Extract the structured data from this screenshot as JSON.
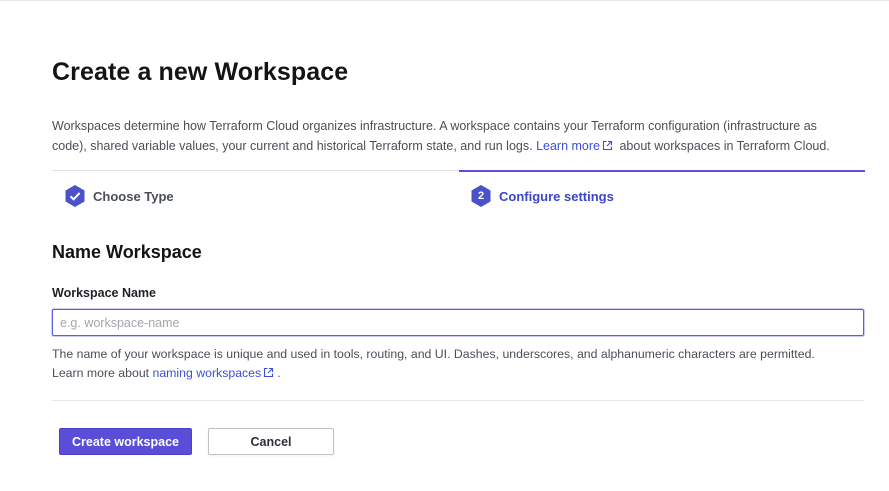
{
  "page": {
    "title": "Create a new Workspace",
    "intro_text": "Workspaces determine how Terraform Cloud organizes infrastructure. A workspace contains your Terraform configuration (infrastructure as code), shared variable values, your current and historical Terraform state, and run logs.",
    "intro_link": "Learn more",
    "intro_suffix": "about workspaces in Terraform Cloud."
  },
  "steps": [
    {
      "label": "Choose Type",
      "status": "complete",
      "icon": "check-icon"
    },
    {
      "number": "2",
      "label": "Configure settings",
      "status": "active"
    }
  ],
  "form": {
    "section_title": "Name Workspace",
    "field_label": "Workspace Name",
    "input_value": "",
    "input_placeholder": "e.g. workspace-name",
    "help_text": "The name of your workspace is unique and used in tools, routing, and UI. Dashes, underscores, and alphanumeric characters are permitted.",
    "help_prefix": "Learn more about",
    "help_link": "naming workspaces",
    "help_suffix": "."
  },
  "actions": {
    "primary_label": "Create workspace",
    "cancel_label": "Cancel"
  },
  "colors": {
    "accent": "#5c4ee5",
    "link": "#3b4fd8",
    "primary_button": "#5a4dd8"
  }
}
